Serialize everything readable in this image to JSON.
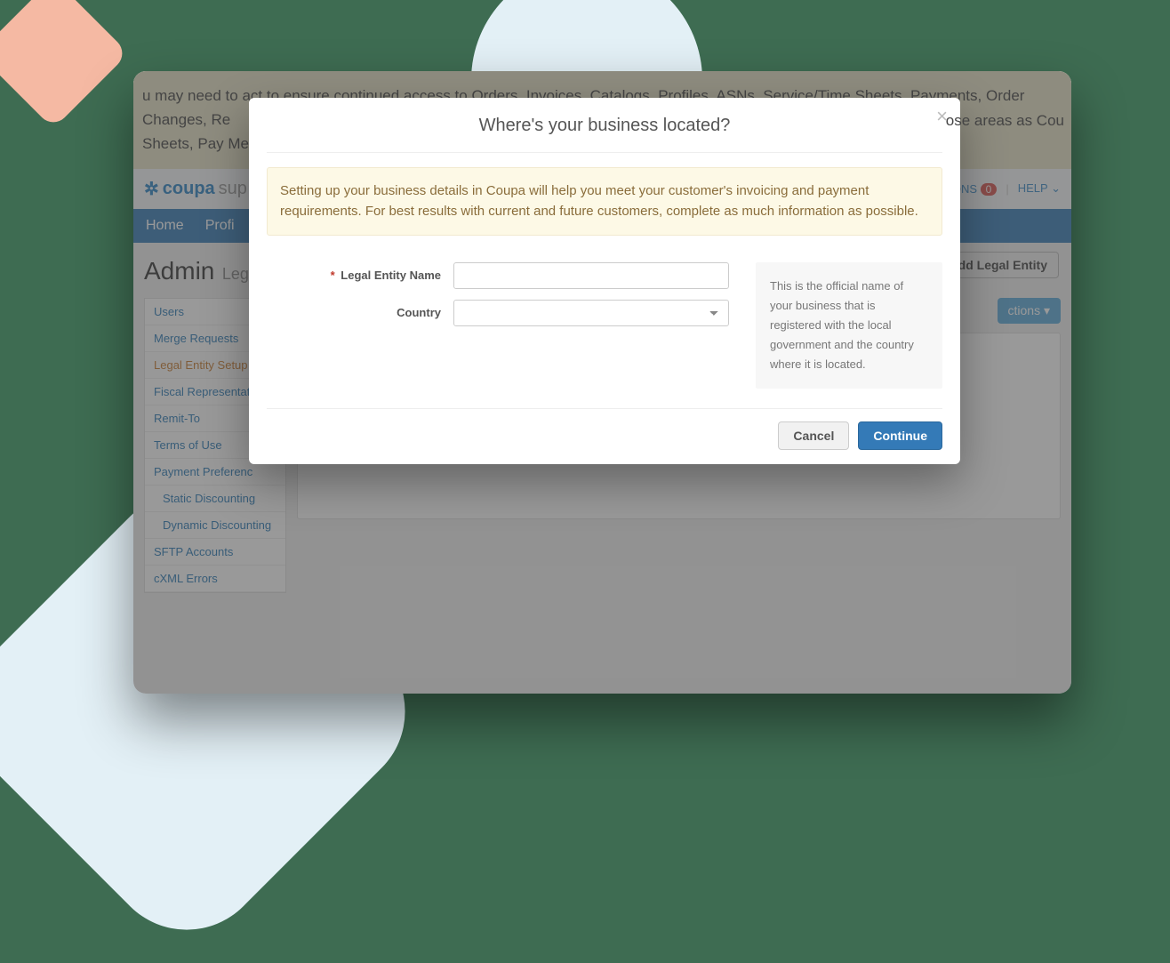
{
  "banner": {
    "line1": "u may need to act to ensure continued access to Orders, Invoices, Catalogs, Profiles, ASNs, Service/Time Sheets, Payments, Order Changes, Re",
    "line2_prefix": "Sheets, Pay Me",
    "line2_suffix": "ose areas as Cou"
  },
  "brand": {
    "name": "coupa",
    "sub": "sup"
  },
  "topright": {
    "ons": "ONS",
    "badge": "0",
    "help": "HELP"
  },
  "nav": {
    "home": "Home",
    "profile": "Profi"
  },
  "page": {
    "title": "Admin",
    "sub": "Leg"
  },
  "buttons": {
    "add_legal_entity": "Add Legal Entity",
    "actions": "ctions"
  },
  "sidebar": {
    "items": [
      "Users",
      "Merge Requests",
      "Legal Entity Setup",
      "Fiscal Representat",
      "Remit-To",
      "Terms of Use",
      "Payment Preferenc",
      "Static Discounting",
      "Dynamic Discounting",
      "SFTP Accounts",
      "cXML Errors"
    ],
    "active_index": 2
  },
  "modal": {
    "title": "Where's your business located?",
    "info": "Setting up your business details in Coupa will help you meet your customer's invoicing and payment requirements. For best results with current and future customers, complete as much information as possible.",
    "fields": {
      "legal_entity_label": "Legal Entity Name",
      "country_label": "Country"
    },
    "help": "This is the official name of your business that is registered with the local government and the country where it is located.",
    "cancel": "Cancel",
    "continue": "Continue"
  }
}
